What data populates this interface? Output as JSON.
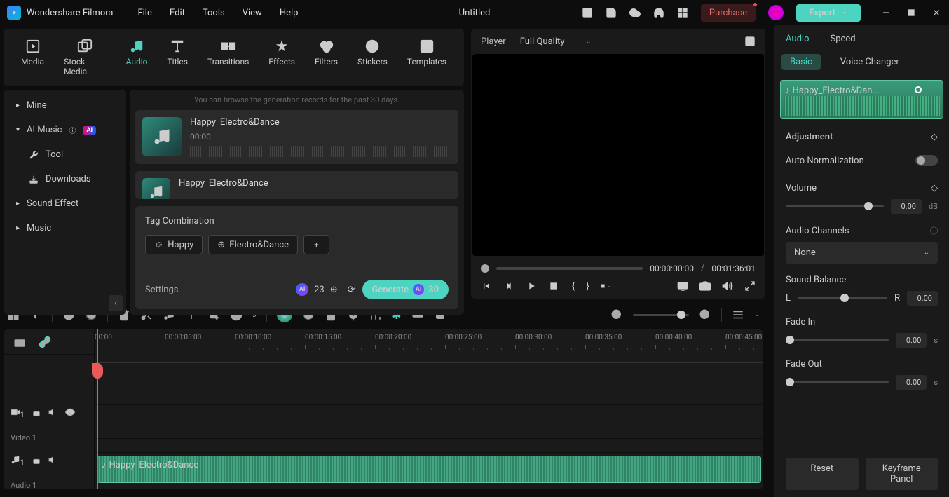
{
  "title": "Wondershare Filmora",
  "docTitle": "Untitled",
  "menu": [
    "File",
    "Edit",
    "Tools",
    "View",
    "Help"
  ],
  "purchase": "Purchase",
  "export": "Export",
  "tabs": [
    {
      "label": "Media"
    },
    {
      "label": "Stock Media"
    },
    {
      "label": "Audio"
    },
    {
      "label": "Titles"
    },
    {
      "label": "Transitions"
    },
    {
      "label": "Effects"
    },
    {
      "label": "Filters"
    },
    {
      "label": "Stickers"
    },
    {
      "label": "Templates"
    }
  ],
  "sidebar": {
    "mine": "Mine",
    "aimusic": "AI Music",
    "tool": "Tool",
    "downloads": "Downloads",
    "soundeffect": "Sound Effect",
    "music": "Music"
  },
  "hint": "You can browse the generation records for the past 30 days.",
  "musicItems": [
    {
      "title": "Happy_Electro&Dance",
      "dur": "00:00"
    },
    {
      "title": "Happy_Electro&Dance",
      "dur": ""
    }
  ],
  "tagPanel": {
    "title": "Tag Combination",
    "tags": [
      "Happy",
      "Electro&Dance"
    ],
    "settings": "Settings",
    "credits": "23",
    "generate": "Generate",
    "genNum": "30"
  },
  "player": {
    "label": "Player",
    "quality": "Full Quality",
    "curTime": "00:00:00:00",
    "totTime": "00:01:36:01"
  },
  "timeline": {
    "ticks": [
      "00:00",
      "00:00:05:00",
      "00:00:10:00",
      "00:00:15:00",
      "00:00:20:00",
      "00:00:25:00",
      "00:00:30:00",
      "00:00:35:00",
      "00:00:40:00",
      "00:00:45:00"
    ],
    "video": "Video 1",
    "audio": "Audio 1",
    "clipName": "Happy_Electro&Dance"
  },
  "rp": {
    "tabs": [
      "Audio",
      "Speed"
    ],
    "subtabs": [
      "Basic",
      "Voice Changer"
    ],
    "clipName": "Happy_Electro&Dan...",
    "adjustment": "Adjustment",
    "autoNorm": "Auto Normalization",
    "volume": "Volume",
    "volVal": "0.00",
    "volUnit": "dB",
    "channels": "Audio Channels",
    "channelVal": "None",
    "balance": "Sound Balance",
    "balL": "L",
    "balR": "R",
    "balVal": "0.00",
    "fadeIn": "Fade In",
    "fadeInVal": "0.00",
    "fadeInUnit": "s",
    "fadeOut": "Fade Out",
    "fadeOutVal": "0.00",
    "fadeOutUnit": "s",
    "reset": "Reset",
    "keyframe": "Keyframe Panel"
  }
}
